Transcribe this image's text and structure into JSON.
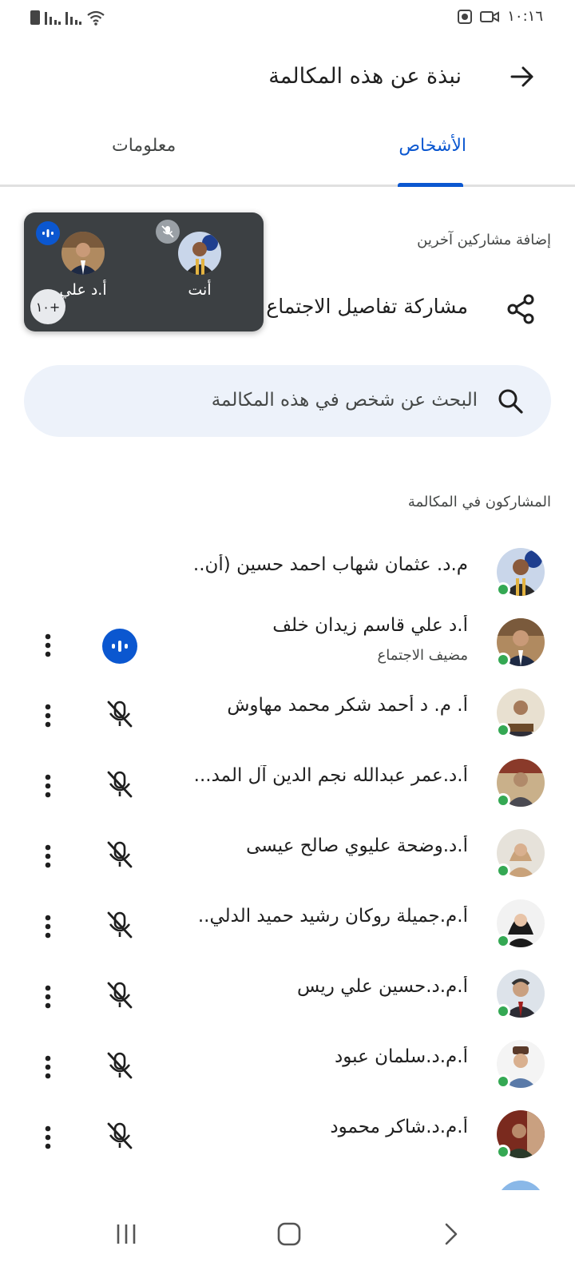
{
  "status_bar": {
    "time": "١٠:١٦",
    "icons": [
      "battery-icon",
      "signal-icon",
      "signal-icon",
      "wifi-icon",
      "screen-record-icon",
      "video-icon"
    ]
  },
  "header": {
    "title": "نبذة عن هذه المكالمة",
    "back_icon": "arrow-right-icon"
  },
  "tabs": [
    {
      "label": "الأشخاص",
      "active": true
    },
    {
      "label": "معلومات",
      "active": false
    }
  ],
  "add_participants_label": "إضافة مشاركين آخرين",
  "share": {
    "label": "مشاركة تفاصيل الاجتماع",
    "icon": "share-icon"
  },
  "popover": {
    "you_label": "أنت",
    "other_label": "أ.د علي",
    "more_count": "+١٠"
  },
  "search": {
    "placeholder": "البحث عن شخص في هذه المكالمة"
  },
  "participants_section_label": "المشاركون في المكالمة",
  "participants": [
    {
      "name": "م.د. عثمان شهاب احمد حسين (أن..",
      "subtitle": "",
      "mic": "none",
      "online": true
    },
    {
      "name": "أ.د علي قاسم زيدان خلف",
      "subtitle": "مضيف الاجتماع",
      "mic": "speaking",
      "online": true
    },
    {
      "name": "أ. م. د أحمد شكر محمد مهاوش",
      "subtitle": "",
      "mic": "muted",
      "online": true
    },
    {
      "name": "أ.د.عمر عبدالله نجم الدين آل المد...",
      "subtitle": "",
      "mic": "muted",
      "online": true
    },
    {
      "name": "أ.د.وضحة عليوي صالح عيسى",
      "subtitle": "",
      "mic": "muted",
      "online": true
    },
    {
      "name": "أ.م.جميلة روكان رشيد حميد الدلي..",
      "subtitle": "",
      "mic": "muted",
      "online": true
    },
    {
      "name": "أ.م.د.حسين علي ريس",
      "subtitle": "",
      "mic": "muted",
      "online": true
    },
    {
      "name": "أ.م.د.سلمان عبود",
      "subtitle": "",
      "mic": "muted",
      "online": true
    },
    {
      "name": "أ.م.د.شاكر محمود",
      "subtitle": "",
      "mic": "muted",
      "online": true
    }
  ],
  "colors": {
    "accent": "#0b57d0",
    "search_bg": "#edf2fa",
    "popover_bg": "#3c4043",
    "online": "#34a853"
  }
}
